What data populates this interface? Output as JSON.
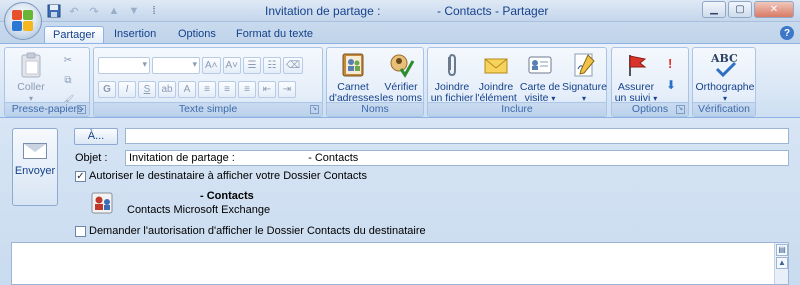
{
  "window": {
    "title_left": "Invitation de partage :",
    "title_right": "- Contacts - Partager"
  },
  "tabs": [
    "Partager",
    "Insertion",
    "Options",
    "Format du texte"
  ],
  "ribbon": {
    "clipboard": {
      "paste_label": "Coller",
      "group_label": "Presse-papiers"
    },
    "basic_text": {
      "group_label": "Texte simple",
      "bold": "G",
      "italic": "I",
      "underline": "S"
    },
    "names": {
      "address_book_l1": "Carnet",
      "address_book_l2": "d'adresses",
      "check_names_l1": "Vérifier",
      "check_names_l2": "les noms",
      "group_label": "Noms"
    },
    "include": {
      "attach_file_l1": "Joindre",
      "attach_file_l2": "un fichier",
      "attach_item_l1": "Joindre",
      "attach_item_l2": "l'élément",
      "business_card_l1": "Carte de",
      "business_card_l2": "visite",
      "signature_l1": "Signature",
      "group_label": "Inclure"
    },
    "options": {
      "follow_up_l1": "Assurer",
      "follow_up_l2": "un suivi",
      "group_label": "Options"
    },
    "proofing": {
      "spelling_l1": "Orthographe",
      "abc": "ABC",
      "group_label": "Vérification"
    }
  },
  "compose": {
    "send_label": "Envoyer",
    "to_label": "À...",
    "to_value": "",
    "subject_label": "Objet :",
    "subject_value": "Invitation de partage :                        - Contacts",
    "allow_label": "Autoriser le destinataire à afficher votre Dossier Contacts",
    "allow_checked": true,
    "folder_name": "- Contacts",
    "folder_store": "Contacts Microsoft Exchange",
    "request_label": "Demander l'autorisation d'afficher le Dossier Contacts du destinataire",
    "request_checked": false
  }
}
